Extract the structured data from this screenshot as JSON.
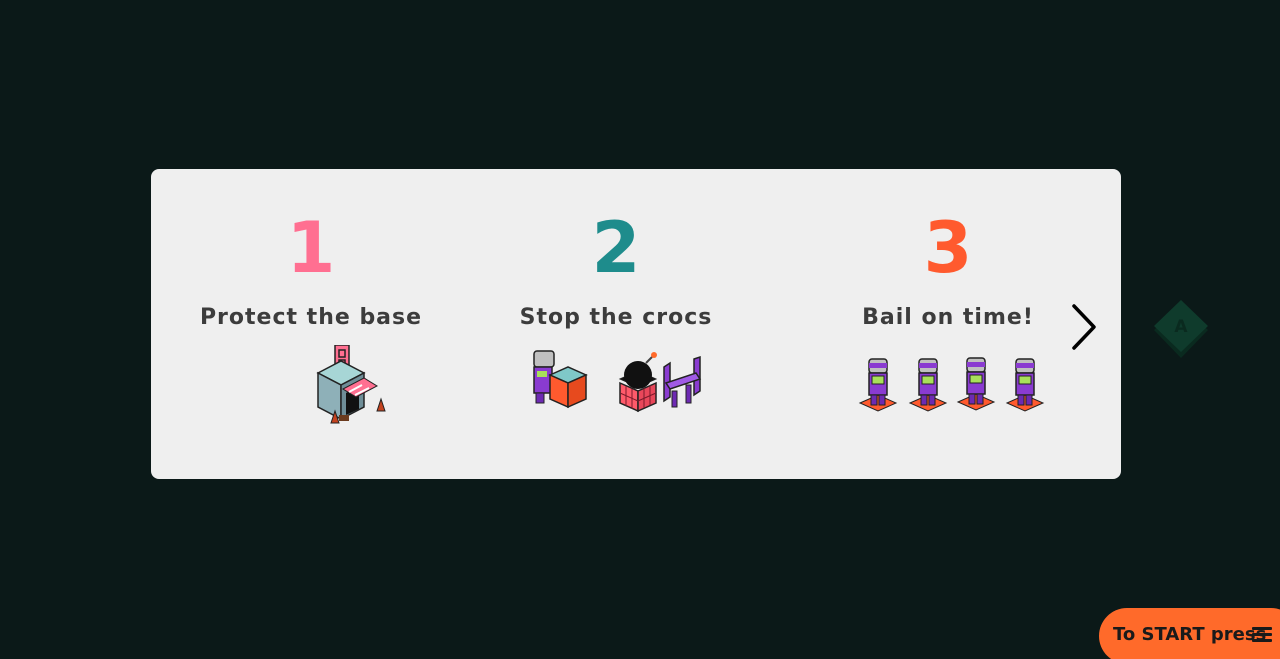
{
  "steps": [
    {
      "number": "1",
      "label": "Protect the base",
      "color": "#ff6f91",
      "art_icon": "base-building-icon"
    },
    {
      "number": "2",
      "label": "Stop the crocs",
      "color": "#1e8c8c",
      "art_icon": "crocs-obstacles-icon"
    },
    {
      "number": "3",
      "label": "Bail on time!",
      "color": "#ff5a2e",
      "art_icon": "four-robots-icon"
    }
  ],
  "next_icon": "chevron-right-icon",
  "a_button": {
    "label": "A",
    "color": "#0f3b2c"
  },
  "start_prompt": {
    "text": "To START press",
    "icon": "menu-icon",
    "color": "#ff6a2a"
  },
  "colors": {
    "background": "#0b1918",
    "panel": "#efefef",
    "text": "#3c3c3c"
  }
}
